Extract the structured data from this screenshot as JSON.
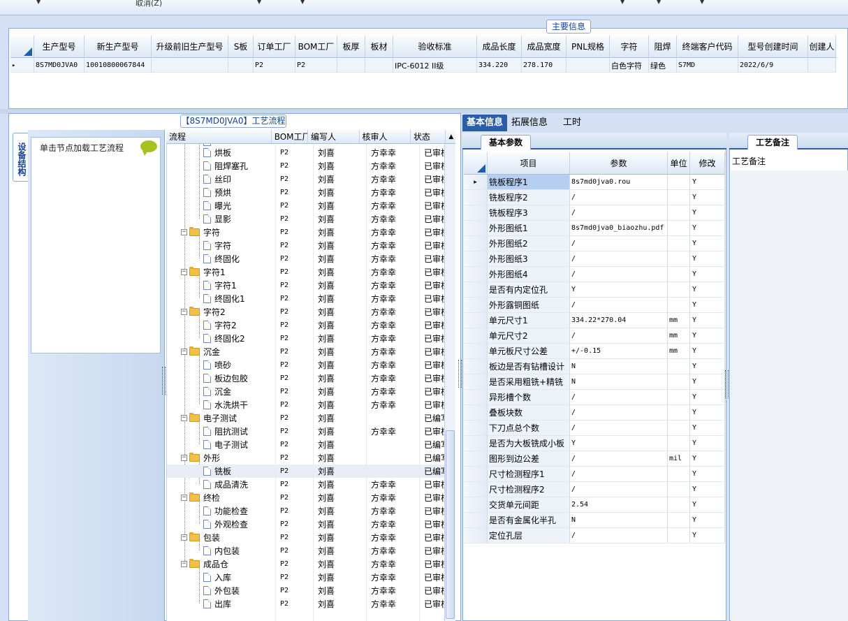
{
  "toolbar": {
    "cancel_label": "取消(Z)"
  },
  "main_info": {
    "title": "主要信息",
    "columns": [
      "生产型号",
      "新生产型号",
      "升级前旧生产型号",
      "S板",
      "订单工厂",
      "BOM工厂",
      "板厚",
      "板材",
      "验收标准",
      "成品长度",
      "成品宽度",
      "PNL规格",
      "字符",
      "阻焊",
      "终端客户代码",
      "型号创建时间",
      "创建人"
    ],
    "row": [
      "8S7MD0JVA0",
      "10010800067844",
      "",
      "",
      "P2",
      "P2",
      "",
      "",
      "IPC-6012 II级",
      "334.220",
      "278.170",
      "",
      "白色字符",
      "绿色",
      "S7MD",
      "2022/6/9",
      ""
    ]
  },
  "device_panel": {
    "tab_label": "设备结构",
    "hint": "单击节点加载工艺流程"
  },
  "flow_panel": {
    "title": "【8S7MD0JVA0】工艺流程",
    "columns": [
      "流程",
      "BOM工厂",
      "编写人",
      "核审人",
      "状态"
    ],
    "rows": [
      {
        "name": "烘板",
        "level": 2,
        "type": "doc",
        "bom": "P2",
        "writer": "刘喜",
        "reviewer": "方幸幸",
        "status": "已审核"
      },
      {
        "name": "阻焊塞孔",
        "level": 2,
        "type": "doc",
        "bom": "P2",
        "writer": "刘喜",
        "reviewer": "方幸幸",
        "status": "已审核"
      },
      {
        "name": "丝印",
        "level": 2,
        "type": "doc",
        "bom": "P2",
        "writer": "刘喜",
        "reviewer": "方幸幸",
        "status": "已审核"
      },
      {
        "name": "预烘",
        "level": 2,
        "type": "doc",
        "bom": "P2",
        "writer": "刘喜",
        "reviewer": "方幸幸",
        "status": "已审核"
      },
      {
        "name": "曝光",
        "level": 2,
        "type": "doc",
        "bom": "P2",
        "writer": "刘喜",
        "reviewer": "方幸幸",
        "status": "已审核"
      },
      {
        "name": "显影",
        "level": 2,
        "type": "doc",
        "bom": "P2",
        "writer": "刘喜",
        "reviewer": "方幸幸",
        "status": "已审核"
      },
      {
        "name": "字符",
        "level": 1,
        "type": "folder",
        "bom": "P2",
        "writer": "刘喜",
        "reviewer": "方幸幸",
        "status": "已审核"
      },
      {
        "name": "字符",
        "level": 2,
        "type": "doc",
        "bom": "P2",
        "writer": "刘喜",
        "reviewer": "方幸幸",
        "status": "已审核"
      },
      {
        "name": "终固化",
        "level": 2,
        "type": "doc",
        "bom": "P2",
        "writer": "刘喜",
        "reviewer": "方幸幸",
        "status": "已审核"
      },
      {
        "name": "字符1",
        "level": 1,
        "type": "folder",
        "bom": "P2",
        "writer": "刘喜",
        "reviewer": "方幸幸",
        "status": "已审核"
      },
      {
        "name": "字符1",
        "level": 2,
        "type": "doc",
        "bom": "P2",
        "writer": "刘喜",
        "reviewer": "方幸幸",
        "status": "已审核"
      },
      {
        "name": "终固化1",
        "level": 2,
        "type": "doc",
        "bom": "P2",
        "writer": "刘喜",
        "reviewer": "方幸幸",
        "status": "已审核"
      },
      {
        "name": "字符2",
        "level": 1,
        "type": "folder",
        "bom": "P2",
        "writer": "刘喜",
        "reviewer": "方幸幸",
        "status": "已审核"
      },
      {
        "name": "字符2",
        "level": 2,
        "type": "doc",
        "bom": "P2",
        "writer": "刘喜",
        "reviewer": "方幸幸",
        "status": "已审核"
      },
      {
        "name": "终固化2",
        "level": 2,
        "type": "doc",
        "bom": "P2",
        "writer": "刘喜",
        "reviewer": "方幸幸",
        "status": "已审核"
      },
      {
        "name": "沉金",
        "level": 1,
        "type": "folder",
        "bom": "P2",
        "writer": "刘喜",
        "reviewer": "方幸幸",
        "status": "已审核"
      },
      {
        "name": "喷砂",
        "level": 2,
        "type": "doc",
        "bom": "P2",
        "writer": "刘喜",
        "reviewer": "方幸幸",
        "status": "已审核"
      },
      {
        "name": "板边包胶",
        "level": 2,
        "type": "doc",
        "bom": "P2",
        "writer": "刘喜",
        "reviewer": "方幸幸",
        "status": "已审核"
      },
      {
        "name": "沉金",
        "level": 2,
        "type": "doc",
        "bom": "P2",
        "writer": "刘喜",
        "reviewer": "方幸幸",
        "status": "已审核"
      },
      {
        "name": "水洗烘干",
        "level": 2,
        "type": "doc",
        "bom": "P2",
        "writer": "刘喜",
        "reviewer": "方幸幸",
        "status": "已审核"
      },
      {
        "name": "电子测试",
        "level": 1,
        "type": "folder",
        "bom": "P2",
        "writer": "刘喜",
        "reviewer": "",
        "status": "已编写"
      },
      {
        "name": "阻抗测试",
        "level": 2,
        "type": "doc",
        "bom": "P2",
        "writer": "刘喜",
        "reviewer": "方幸幸",
        "status": "已审核"
      },
      {
        "name": "电子测试",
        "level": 2,
        "type": "doc",
        "bom": "P2",
        "writer": "刘喜",
        "reviewer": "",
        "status": "已编写"
      },
      {
        "name": "外形",
        "level": 1,
        "type": "folder",
        "bom": "P2",
        "writer": "刘喜",
        "reviewer": "",
        "status": "已编写"
      },
      {
        "name": "铣板",
        "level": 2,
        "type": "doc",
        "bom": "P2",
        "writer": "刘喜",
        "reviewer": "",
        "status": "已编写",
        "selected": true
      },
      {
        "name": "成品清洗",
        "level": 2,
        "type": "doc",
        "bom": "P2",
        "writer": "刘喜",
        "reviewer": "方幸幸",
        "status": "已审核"
      },
      {
        "name": "终检",
        "level": 1,
        "type": "folder",
        "bom": "P2",
        "writer": "刘喜",
        "reviewer": "方幸幸",
        "status": "已审核"
      },
      {
        "name": "功能检查",
        "level": 2,
        "type": "doc",
        "bom": "P2",
        "writer": "刘喜",
        "reviewer": "方幸幸",
        "status": "已审核"
      },
      {
        "name": "外观检查",
        "level": 2,
        "type": "doc",
        "bom": "P2",
        "writer": "刘喜",
        "reviewer": "方幸幸",
        "status": "已审核"
      },
      {
        "name": "包装",
        "level": 1,
        "type": "folder",
        "bom": "P2",
        "writer": "刘喜",
        "reviewer": "方幸幸",
        "status": "已审核"
      },
      {
        "name": "内包装",
        "level": 2,
        "type": "doc",
        "bom": "P2",
        "writer": "刘喜",
        "reviewer": "方幸幸",
        "status": "已审核"
      },
      {
        "name": "成品仓",
        "level": 1,
        "type": "folder",
        "bom": "P2",
        "writer": "刘喜",
        "reviewer": "方幸幸",
        "status": "已审核"
      },
      {
        "name": "入库",
        "level": 2,
        "type": "doc",
        "bom": "P2",
        "writer": "刘喜",
        "reviewer": "方幸幸",
        "status": "已审核"
      },
      {
        "name": "外包装",
        "level": 2,
        "type": "doc",
        "bom": "P2",
        "writer": "刘喜",
        "reviewer": "方幸幸",
        "status": "已审核"
      },
      {
        "name": "出库",
        "level": 2,
        "type": "doc",
        "bom": "P2",
        "writer": "刘喜",
        "reviewer": "方幸幸",
        "status": "已审核"
      }
    ]
  },
  "right_tabs": [
    {
      "label": "基本信息",
      "active": true
    },
    {
      "label": "拓展信息"
    },
    {
      "label": "工时"
    }
  ],
  "basic_params": {
    "tab_label": "基本参数",
    "columns": [
      "项目",
      "参数",
      "单位",
      "修改"
    ],
    "rows": [
      {
        "item": "铣板程序1",
        "value": "8s7md0jva0.rou",
        "unit": "",
        "mod": "Y"
      },
      {
        "item": "铣板程序2",
        "value": "/",
        "unit": "",
        "mod": "Y"
      },
      {
        "item": "铣板程序3",
        "value": "/",
        "unit": "",
        "mod": "Y"
      },
      {
        "item": "外形图纸1",
        "value": "8s7md0jva0_biaozhu.pdf",
        "unit": "",
        "mod": "Y"
      },
      {
        "item": "外形图纸2",
        "value": "/",
        "unit": "",
        "mod": "Y"
      },
      {
        "item": "外形图纸3",
        "value": "/",
        "unit": "",
        "mod": "Y"
      },
      {
        "item": "外形图纸4",
        "value": "/",
        "unit": "",
        "mod": "Y"
      },
      {
        "item": "是否有内定位孔",
        "value": "Y",
        "unit": "",
        "mod": "Y"
      },
      {
        "item": "外形露铜图纸",
        "value": "/",
        "unit": "",
        "mod": "Y"
      },
      {
        "item": "单元尺寸1",
        "value": "334.22*270.04",
        "unit": "mm",
        "mod": "Y"
      },
      {
        "item": "单元尺寸2",
        "value": "/",
        "unit": "mm",
        "mod": "Y"
      },
      {
        "item": "单元板尺寸公差",
        "value": "+/-0.15",
        "unit": "mm",
        "mod": "Y"
      },
      {
        "item": "板边是否有钻槽设计",
        "value": "N",
        "unit": "",
        "mod": "Y"
      },
      {
        "item": "是否采用粗铣+精铣",
        "value": "N",
        "unit": "",
        "mod": "Y"
      },
      {
        "item": "异形槽个数",
        "value": "/",
        "unit": "",
        "mod": "Y"
      },
      {
        "item": "叠板块数",
        "value": "/",
        "unit": "",
        "mod": "Y"
      },
      {
        "item": "下刀点总个数",
        "value": "/",
        "unit": "",
        "mod": "Y"
      },
      {
        "item": "是否为大板铣成小板",
        "value": "Y",
        "unit": "",
        "mod": "Y"
      },
      {
        "item": "图形到边公差",
        "value": "/",
        "unit": "mil",
        "mod": "Y"
      },
      {
        "item": "尺寸检测程序1",
        "value": "/",
        "unit": "",
        "mod": "Y"
      },
      {
        "item": "尺寸检测程序2",
        "value": "/",
        "unit": "",
        "mod": "Y"
      },
      {
        "item": "交货单元间距",
        "value": "2.54",
        "unit": "",
        "mod": "Y"
      },
      {
        "item": "是否有金属化半孔",
        "value": "N",
        "unit": "",
        "mod": "Y"
      },
      {
        "item": "定位孔层",
        "value": "/",
        "unit": "",
        "mod": "Y"
      }
    ]
  },
  "notes": {
    "tab_label": "工艺备注",
    "label": "工艺备注"
  }
}
